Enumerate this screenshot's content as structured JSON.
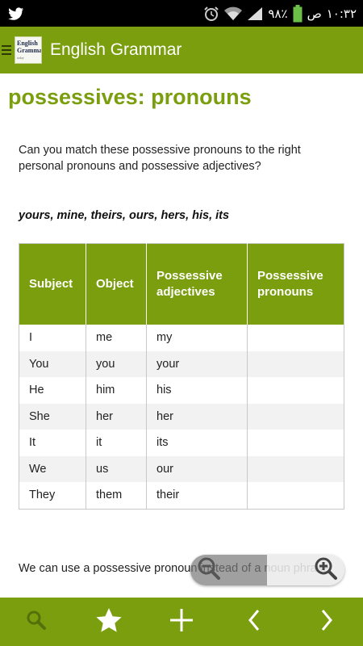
{
  "status_bar": {
    "app_icon": "twitter-bird-icon",
    "battery_percent": "٩٨٪",
    "time": "١٠:٣٢",
    "ampm": "ص",
    "icons": [
      "alarm-clock-icon",
      "wifi-icon",
      "signal-icon",
      "battery-icon"
    ]
  },
  "action_bar": {
    "menu_icon": "hamburger-menu-icon",
    "logo_line1": "English",
    "logo_line2": "Grammar",
    "logo_line3": "today",
    "title": "English Grammar"
  },
  "article": {
    "heading": "possessives: pronouns",
    "intro": "Can you match these possessive pronouns to the right personal pronouns and possessive adjectives?",
    "words": "yours, mine, theirs, ours, hers, his, its",
    "table": {
      "headers": [
        "Subject",
        "Object",
        "Possessive adjectives",
        "Possessive pronouns"
      ],
      "rows": [
        [
          "I",
          "me",
          "my",
          ""
        ],
        [
          "You",
          "you",
          "your",
          ""
        ],
        [
          "He",
          "him",
          "his",
          ""
        ],
        [
          "She",
          "her",
          "her",
          ""
        ],
        [
          "It",
          "it",
          "its",
          ""
        ],
        [
          "We",
          "us",
          "our",
          ""
        ],
        [
          "They",
          "them",
          "their",
          ""
        ]
      ]
    },
    "bottom_text": "We can use a possessive pronoun instead of a noun phrase"
  },
  "zoom_control": {
    "zoom_out_icon": "zoom-out-icon",
    "zoom_in_icon": "zoom-in-icon"
  },
  "toolbar": {
    "items": [
      "search-icon",
      "star-icon",
      "plus-icon",
      "chevron-left-icon",
      "chevron-right-icon"
    ]
  },
  "colors": {
    "brand_green": "#7a9e0e",
    "status_bar": "#000000",
    "row_alt": "#f2f2f2"
  }
}
